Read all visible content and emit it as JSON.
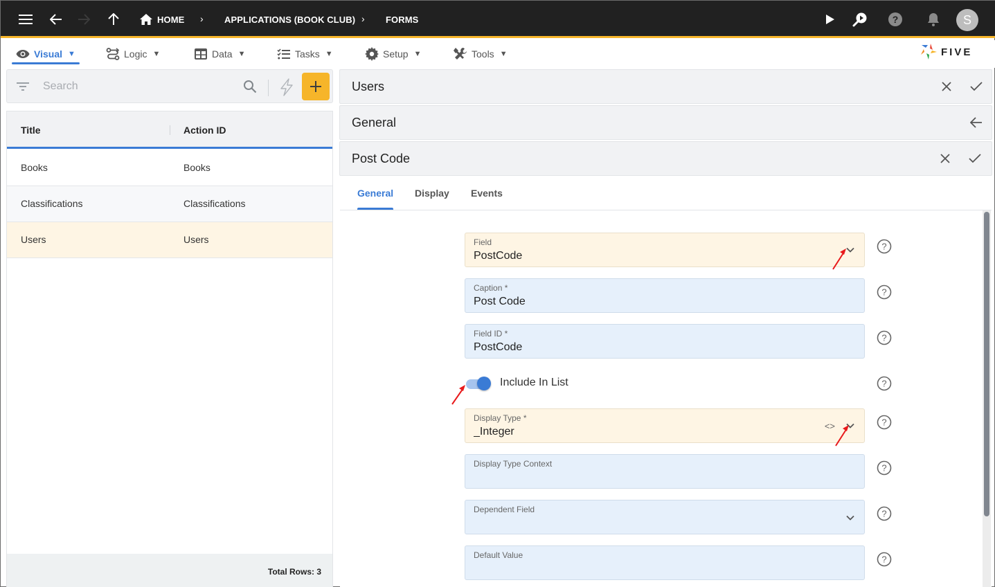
{
  "topbar": {
    "breadcrumbs": [
      "HOME",
      "APPLICATIONS (BOOK CLUB)",
      "FORMS"
    ],
    "avatar_initial": "S",
    "icons": [
      "menu-icon",
      "back-arrow-icon",
      "forward-arrow-icon",
      "up-arrow-icon",
      "home-icon",
      "play-icon",
      "search-play-icon",
      "help-icon",
      "bell-icon"
    ]
  },
  "menubar": {
    "items": [
      {
        "label": "Visual",
        "icon": "eye-icon",
        "active": true
      },
      {
        "label": "Logic",
        "icon": "flow-icon"
      },
      {
        "label": "Data",
        "icon": "table-icon"
      },
      {
        "label": "Tasks",
        "icon": "checklist-icon"
      },
      {
        "label": "Setup",
        "icon": "gear-icon"
      },
      {
        "label": "Tools",
        "icon": "tools-icon"
      }
    ],
    "arrow": "▼",
    "logo_text": "FIVE"
  },
  "search": {
    "placeholder": "Search",
    "value": ""
  },
  "list": {
    "columns": [
      "Title",
      "Action ID"
    ],
    "rows": [
      {
        "title": "Books",
        "action_id": "Books"
      },
      {
        "title": "Classifications",
        "action_id": "Classifications"
      },
      {
        "title": "Users",
        "action_id": "Users",
        "selected": true
      }
    ],
    "footer": "Total Rows: 3"
  },
  "stack": {
    "panels": [
      {
        "title": "Users"
      },
      {
        "title": "General"
      },
      {
        "title": "Post Code"
      }
    ]
  },
  "form": {
    "tabs": [
      "General",
      "Display",
      "Events"
    ],
    "active_tab": "General",
    "fields": {
      "field": {
        "label": "Field",
        "value": "PostCode"
      },
      "caption": {
        "label": "Caption *",
        "value": "Post Code"
      },
      "field_id": {
        "label": "Field ID *",
        "value": "PostCode"
      },
      "include_in_list": {
        "label": "Include In List",
        "checked": true
      },
      "display_type": {
        "label": "Display Type *",
        "value": "_Integer",
        "code_icon": "<>"
      },
      "display_type_context": {
        "label": "Display Type Context",
        "value": ""
      },
      "dependent_field": {
        "label": "Dependent Field",
        "value": ""
      },
      "default_value": {
        "label": "Default Value",
        "value": ""
      }
    }
  },
  "colors": {
    "accent": "#3a7bd5",
    "brand_yellow": "#f6b52a",
    "topbar": "#212121",
    "lookup_field_bg": "#fef5e4",
    "input_field_bg": "#e6f0fb",
    "annotation_arrow": "#e8191b"
  }
}
